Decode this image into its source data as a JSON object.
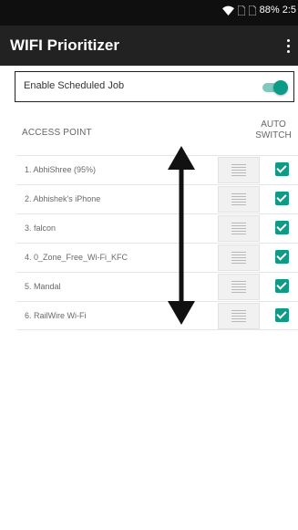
{
  "status_bar": {
    "battery_time": "88% 2:5",
    "icons": [
      "wifi-icon",
      "sim-icon",
      "sim-icon",
      "battery-icon"
    ]
  },
  "app_bar": {
    "title": "WIFI Prioritizer",
    "menu_icon": "overflow-menu-icon"
  },
  "scheduled": {
    "label": "Enable Scheduled Job",
    "enabled": true,
    "accent": "#0b9b86"
  },
  "columns": {
    "access_point": "ACCESS POINT",
    "auto_switch": "AUTO\nSWITCH"
  },
  "access_points": [
    {
      "label": "1. AbhiShree (95%)",
      "auto_switch": true
    },
    {
      "label": "2. Abhishek's iPhone",
      "auto_switch": true
    },
    {
      "label": "3. falcon",
      "auto_switch": true
    },
    {
      "label": "4. 0_Zone_Free_Wi-Fi_KFC",
      "auto_switch": true
    },
    {
      "label": "5. Mandal",
      "auto_switch": true
    },
    {
      "label": "6. RailWire Wi-Fi",
      "auto_switch": true
    }
  ],
  "annotation": {
    "icon": "double-headed-arrow"
  }
}
